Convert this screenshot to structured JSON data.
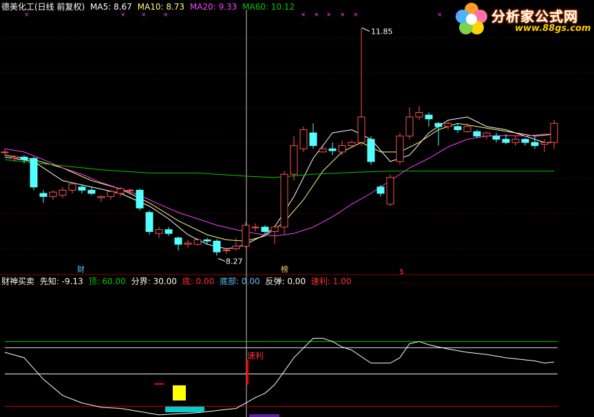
{
  "colors": {
    "background": "#000000",
    "up": "#ff5555",
    "down": "#54ffff",
    "ma5": "#ffffff",
    "ma10": "#ffff80",
    "ma20": "#ff40ff",
    "ma60": "#00cc00",
    "grid": "#8b0000",
    "osc_line": "#ffffff",
    "top_line": "#00cc00",
    "mid_line": "#ffffff",
    "bottom_line": "#cc0000",
    "signal": "#ff0000",
    "buy_block": "#ffff00",
    "bottom_block": "#00cccc"
  },
  "header": {
    "stock": "德美化工(日线 前复权)",
    "ma5": "MA5: 8.67",
    "ma10": "MA10: 8.73",
    "ma20": "MA20: 9.33",
    "ma60": "MA60: 10.12"
  },
  "indicator_header": {
    "name": "财神买卖",
    "xianzhi": "先知: -9.13",
    "ding": "顶: 60.00",
    "fenjie": "分界: 30.00",
    "di": "底: 0.00",
    "dibu": "底部: 0.00",
    "fantan": "反弹: 0.00",
    "suli": "速利: 1.00"
  },
  "logo": {
    "text": "分析家公式网",
    "url": "www.88gs.com"
  },
  "chart_data": [
    {
      "type": "candlestick",
      "title": "德美化工(日线 前复权)",
      "annotations": {
        "high_label": "11.85",
        "low_label": "8.27",
        "markers": [
          "财",
          "榜",
          "$"
        ]
      },
      "candles": [
        [
          0.0,
          9.9,
          9.9,
          9.85,
          9.95
        ],
        [
          1.0,
          9.8,
          9.82,
          9.75,
          9.86
        ],
        [
          2.0,
          9.82,
          9.78,
          9.72,
          9.85
        ],
        [
          3.0,
          9.8,
          9.35,
          9.3,
          9.82
        ],
        [
          4.0,
          9.25,
          9.2,
          9.1,
          9.3
        ],
        [
          5.0,
          9.2,
          9.27,
          9.15,
          9.3
        ],
        [
          6.0,
          9.22,
          9.3,
          9.18,
          9.35
        ],
        [
          7.0,
          9.3,
          9.4,
          9.25,
          9.42
        ],
        [
          8.0,
          9.35,
          9.3,
          9.25,
          9.38
        ],
        [
          9.0,
          9.3,
          9.25,
          9.22,
          9.35
        ],
        [
          10.0,
          9.18,
          9.2,
          9.12,
          9.22
        ],
        [
          11.0,
          9.2,
          9.28,
          9.15,
          9.3
        ],
        [
          12.0,
          9.25,
          9.32,
          9.2,
          9.35
        ],
        [
          13.0,
          9.3,
          9.3,
          9.25,
          9.33
        ],
        [
          14.0,
          9.3,
          9.02,
          8.98,
          9.32
        ],
        [
          15.0,
          8.95,
          8.65,
          8.6,
          8.98
        ],
        [
          16.0,
          8.62,
          8.68,
          8.55,
          8.72
        ],
        [
          17.0,
          8.68,
          8.62,
          8.58,
          8.72
        ],
        [
          18.0,
          8.55,
          8.45,
          8.35,
          8.57
        ],
        [
          19.0,
          8.45,
          8.47,
          8.4,
          8.52
        ],
        [
          20.0,
          8.45,
          8.52,
          8.43,
          8.55
        ],
        [
          21.0,
          8.52,
          8.5,
          8.45,
          8.55
        ],
        [
          22.0,
          8.5,
          8.33,
          8.27,
          8.53
        ],
        [
          23.0,
          8.35,
          8.36,
          8.3,
          8.38
        ],
        [
          24.0,
          8.38,
          8.42,
          8.35,
          8.55
        ],
        [
          25.0,
          8.42,
          8.75,
          8.4,
          8.8
        ],
        [
          26.0,
          8.72,
          8.72,
          8.65,
          8.78
        ],
        [
          27.0,
          8.72,
          8.65,
          8.6,
          8.75
        ],
        [
          28.0,
          8.65,
          8.72,
          8.45,
          8.75
        ],
        [
          29.0,
          8.72,
          9.55,
          8.6,
          9.6
        ],
        [
          30.0,
          9.55,
          10.0,
          9.45,
          10.15
        ],
        [
          31.0,
          9.95,
          10.25,
          9.9,
          10.3
        ],
        [
          32.0,
          10.2,
          10.0,
          9.95,
          10.35
        ],
        [
          33.0,
          9.9,
          9.95,
          9.9,
          10.0
        ],
        [
          34.0,
          9.95,
          9.92,
          9.85,
          10.05
        ],
        [
          35.0,
          9.9,
          10.0,
          9.85,
          10.08
        ],
        [
          36.0,
          10.0,
          10.05,
          9.98,
          10.08
        ],
        [
          37.0,
          10.05,
          10.45,
          10.0,
          11.85
        ],
        [
          38.0,
          10.1,
          9.75,
          9.7,
          10.15
        ],
        [
          39.0,
          9.35,
          9.25,
          9.2,
          9.38
        ],
        [
          40.0,
          9.08,
          9.5,
          9.05,
          9.55
        ],
        [
          41.0,
          9.75,
          10.15,
          9.7,
          10.2
        ],
        [
          42.0,
          10.15,
          10.45,
          10.1,
          10.6
        ],
        [
          43.0,
          10.45,
          10.52,
          10.4,
          10.62
        ],
        [
          44.0,
          10.48,
          10.42,
          10.3,
          10.52
        ],
        [
          45.0,
          10.35,
          10.3,
          10.0,
          10.37
        ],
        [
          46.0,
          10.3,
          10.35,
          10.25,
          10.38
        ],
        [
          47.0,
          10.3,
          10.25,
          10.2,
          10.35
        ],
        [
          48.0,
          10.22,
          10.3,
          10.2,
          10.35
        ],
        [
          49.0,
          10.22,
          10.15,
          10.12,
          10.25
        ],
        [
          50.0,
          10.15,
          10.2,
          10.1,
          10.22
        ],
        [
          51.0,
          10.15,
          10.1,
          10.05,
          10.2
        ],
        [
          52.0,
          10.1,
          10.05,
          10.02,
          10.18
        ],
        [
          53.0,
          10.05,
          10.1,
          10.0,
          10.15
        ],
        [
          54.0,
          10.1,
          10.05,
          10.0,
          10.12
        ],
        [
          55.0,
          10.05,
          10.0,
          9.95,
          10.15
        ],
        [
          56.0,
          10.02,
          10.05,
          9.9,
          10.1
        ],
        [
          57.0,
          10.05,
          10.35,
          9.95,
          10.4
        ]
      ],
      "candle_fields": [
        "index",
        "open",
        "close",
        "low",
        "high"
      ],
      "ylim": [
        8.05,
        12.05
      ],
      "series": [
        {
          "name": "MA5",
          "x": [
            0,
            3,
            6,
            9,
            12,
            15,
            17,
            19,
            21,
            23,
            24,
            25,
            27,
            28,
            30,
            32,
            34,
            36,
            38,
            40,
            42,
            44,
            46,
            48,
            50,
            52,
            54,
            56,
            57
          ],
          "values": [
            9.82,
            9.75,
            9.45,
            9.35,
            9.25,
            9.05,
            8.85,
            8.6,
            8.45,
            8.38,
            8.4,
            8.45,
            8.6,
            8.72,
            9.2,
            9.8,
            10.2,
            10.25,
            10.1,
            9.75,
            9.85,
            10.2,
            10.4,
            10.45,
            10.3,
            10.25,
            10.15,
            10.05,
            10.05
          ]
        },
        {
          "name": "MA10",
          "x": [
            0,
            3,
            6,
            9,
            12,
            15,
            18,
            21,
            23,
            25,
            27,
            29,
            31,
            33,
            35,
            37,
            39,
            41,
            43,
            45,
            47,
            49,
            51,
            53,
            55,
            57
          ],
          "values": [
            9.85,
            9.78,
            9.65,
            9.45,
            9.32,
            9.1,
            8.82,
            8.6,
            8.52,
            8.5,
            8.58,
            8.8,
            9.15,
            9.6,
            9.9,
            10.05,
            9.9,
            9.9,
            10.05,
            10.25,
            10.35,
            10.3,
            10.25,
            10.2,
            10.15,
            10.18
          ]
        },
        {
          "name": "MA20",
          "x": [
            0,
            2,
            4,
            6,
            8,
            10,
            12,
            14,
            16,
            18,
            20,
            22,
            24,
            26,
            28,
            30,
            32,
            34,
            36,
            38,
            40,
            42,
            44,
            46,
            48,
            50,
            52,
            54,
            56,
            57
          ],
          "values": [
            9.95,
            9.9,
            9.78,
            9.65,
            9.55,
            9.42,
            9.32,
            9.22,
            9.08,
            8.95,
            8.85,
            8.75,
            8.68,
            8.62,
            8.58,
            8.62,
            8.72,
            8.88,
            9.08,
            9.25,
            9.45,
            9.65,
            9.8,
            9.98,
            10.1,
            10.15,
            10.16,
            10.15,
            10.18,
            10.18
          ]
        },
        {
          "name": "MA60",
          "x": [
            0,
            5,
            10,
            15,
            20,
            25,
            28,
            32,
            36,
            40,
            45,
            50,
            55,
            57
          ],
          "values": [
            9.78,
            9.7,
            9.62,
            9.57,
            9.57,
            9.52,
            9.5,
            9.55,
            9.58,
            9.6,
            9.6,
            9.6,
            9.6,
            9.6
          ]
        }
      ]
    },
    {
      "type": "line",
      "title": "财神买卖",
      "ylim": [
        -10,
        110
      ],
      "reference_lines": {
        "ding": 60,
        "fenjie": 30,
        "di": 0
      },
      "series": [
        {
          "name": "先知",
          "x": [
            0,
            2,
            4,
            6,
            8,
            10,
            12,
            14,
            16,
            18,
            20,
            22,
            23,
            24,
            25,
            26,
            27,
            28,
            30,
            32,
            33,
            34,
            35,
            36,
            38,
            40,
            41,
            42,
            43,
            44,
            46,
            48,
            50,
            52,
            54,
            55,
            56,
            57
          ],
          "values": [
            50,
            45,
            25,
            10,
            3,
            -1,
            -2,
            -5,
            -8,
            -7,
            -6,
            -4,
            -3,
            -2,
            3,
            8,
            12,
            20,
            45,
            63,
            63,
            60,
            55,
            52,
            40,
            40,
            45,
            58,
            60,
            57,
            53,
            50,
            48,
            45,
            43,
            42,
            40,
            41
          ]
        }
      ],
      "signals": {
        "label": "速利",
        "buy_block_label": "",
        "bottom_block_label": ""
      }
    }
  ]
}
